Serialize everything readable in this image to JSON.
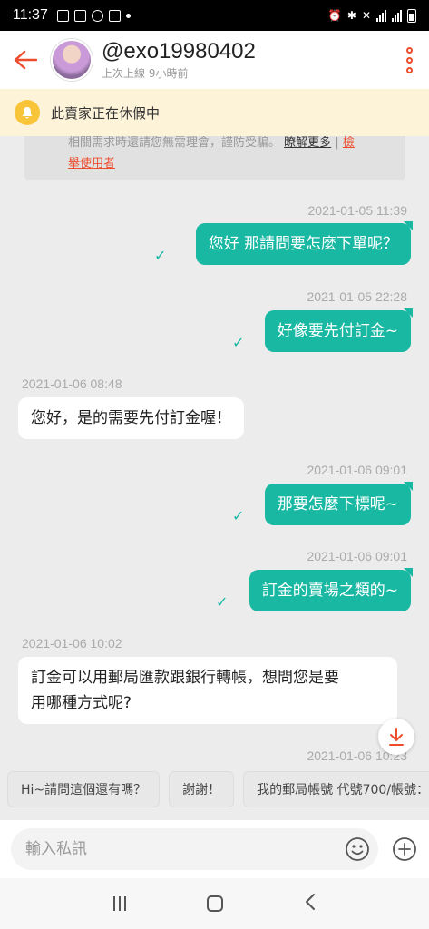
{
  "status_bar": {
    "time": "11:37"
  },
  "header": {
    "username": "@exo19980402",
    "last_seen": "上次上線 9小時前"
  },
  "banner": {
    "text": "此賣家正在休假中"
  },
  "notice": {
    "text": "相關需求時還請您無需理會，謹防受騙。",
    "learn_more": "瞭解更多",
    "separator": "|",
    "report_line1": "檢",
    "report_line2": "舉使用者"
  },
  "messages": [
    {
      "time": "2021-01-05 11:39",
      "direction": "out",
      "text": "您好 那請問要怎麼下單呢？"
    },
    {
      "time": "2021-01-05 22:28",
      "direction": "out",
      "text": "好像要先付訂金~"
    },
    {
      "time": "2021-01-06 08:48",
      "direction": "in",
      "text": "您好，是的需要先付訂金喔！"
    },
    {
      "time": "2021-01-06 09:01",
      "direction": "out",
      "text": "那要怎麼下標呢~"
    },
    {
      "time": "2021-01-06 09:01",
      "direction": "out",
      "text": "訂金的賣場之類的~"
    },
    {
      "time": "2021-01-06 10:02",
      "direction": "in",
      "text_line1": "訂金可以用郵局匯款跟銀行轉帳，想問您是要",
      "text_line2": "用哪種方式呢?"
    },
    {
      "time": "2021-01-06 10:23"
    }
  ],
  "quick_replies": [
    "Hi~請問這個還有嗎？",
    "謝謝！",
    "我的郵局帳號 代號700/帳號："
  ],
  "input": {
    "placeholder": "輸入私訊"
  },
  "colors": {
    "accent": "#ee4d2d",
    "bubble_out": "#19b8a3",
    "banner_bg": "#fdf3d8"
  }
}
